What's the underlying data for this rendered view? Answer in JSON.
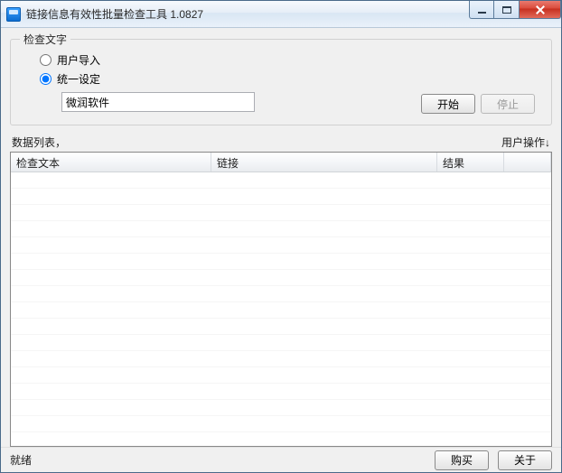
{
  "window": {
    "title": "链接信息有效性批量检查工具 1.0827"
  },
  "group": {
    "legend": "检查文字",
    "radio_user_import": "用户导入",
    "radio_unified": "统一设定",
    "input_value": "微润软件",
    "start_label": "开始",
    "stop_label": "停止",
    "selected": "unified"
  },
  "labels": {
    "data_list": "数据列表，",
    "user_op": "用户操作↓"
  },
  "table": {
    "columns": {
      "text": "检查文本",
      "link": "链接",
      "result": "结果"
    },
    "rows": []
  },
  "status": {
    "text": "就绪",
    "buy_label": "购买",
    "about_label": "关于"
  }
}
